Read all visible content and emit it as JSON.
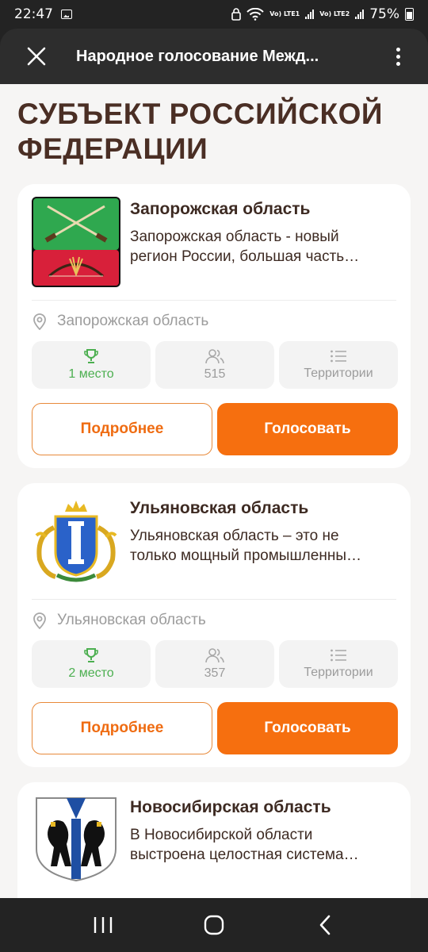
{
  "status": {
    "time": "22:47",
    "lte1": "Vo) LTE1",
    "lte2": "Vo) LTE2",
    "battery": "75%"
  },
  "appbar": {
    "title": "Народное голосование Межд...",
    "close_icon": "close-icon",
    "menu_icon": "more-vert-icon"
  },
  "page": {
    "title": "СУБЪЕКТ РОССИЙСКОЙ ФЕДЕРАЦИИ"
  },
  "cards": [
    {
      "name": "Запорожская область",
      "desc_line1": "Запорожская область - новый",
      "desc_line2": "регион России, большая часть…",
      "region": "Запорожская область",
      "place": "1 место",
      "votes": "515",
      "category": "Территории",
      "more_label": "Подробнее",
      "vote_label": "Голосовать"
    },
    {
      "name": "Ульяновская область",
      "desc_line1": "Ульяновская область – это не",
      "desc_line2": "только мощный промышленны…",
      "region": "Ульяновская область",
      "place": "2 место",
      "votes": "357",
      "category": "Территории",
      "more_label": "Подробнее",
      "vote_label": "Голосовать"
    },
    {
      "name": "Новосибирская область",
      "desc_line1": "В Новосибирской области",
      "desc_line2": "выстроена целостная система…"
    }
  ],
  "colors": {
    "accent": "#f66f0f",
    "title": "#4a2e24",
    "place_green": "#4caf50",
    "background": "#f6f5f4"
  },
  "navbar": {
    "recents_icon": "recent-apps-icon",
    "home_icon": "home-icon",
    "back_icon": "back-icon"
  }
}
